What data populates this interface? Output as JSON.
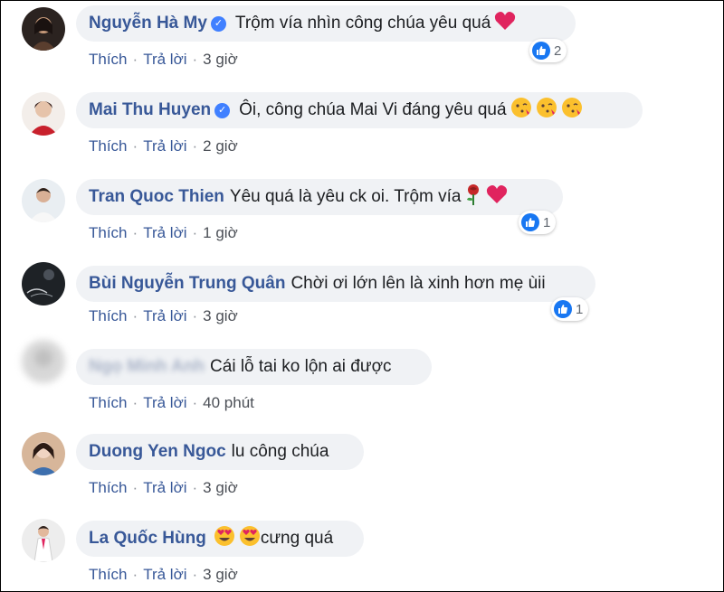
{
  "actions": {
    "like": "Thích",
    "reply": "Trả lời",
    "separator": "·"
  },
  "comments": [
    {
      "author": "Nguyễn Hà My",
      "text": "Trộm vía nhìn công chúa yêu quá",
      "time": "3 giờ",
      "reactions": "2",
      "verified": true,
      "emojis": [
        "heart-icon"
      ]
    },
    {
      "author": "Mai Thu Huyen",
      "text": "Ôi, công chúa Mai Vi đáng yêu quá",
      "time": "2 giờ",
      "reactions": "",
      "verified": true,
      "emojis": [
        "kiss-face-icon",
        "kiss-face-icon",
        "kiss-face-icon"
      ]
    },
    {
      "author": "Tran Quoc Thien",
      "text": "Yêu quá là yêu ck oi. Trộm vía",
      "time": "1 giờ",
      "reactions": "1",
      "verified": false,
      "emojis": [
        "rose-icon",
        "heart-icon"
      ]
    },
    {
      "author": "Bùi Nguyễn Trung Quân",
      "text": "Chời ơi lớn lên là xinh hơn mẹ ùii",
      "time": "3 giờ",
      "reactions": "1",
      "verified": false,
      "emojis": []
    },
    {
      "author": "Ngọ Minh Anh",
      "text": "Cái lỗ tai ko lộn ai được",
      "time": "40 phút",
      "reactions": "",
      "verified": false,
      "emojis": []
    },
    {
      "author": "Duong Yen Ngoc",
      "text": "lu công chúa",
      "time": "3 giờ",
      "reactions": "",
      "verified": false,
      "emojis": []
    },
    {
      "author": "La Quốc Hùng",
      "text": "cưng quá",
      "time": "3 giờ",
      "reactions": "",
      "verified": false,
      "emojis": [
        "heart-eyes-icon",
        "heart-eyes-icon"
      ]
    }
  ],
  "colors": {
    "author": "#385898",
    "bubble": "#f0f2f5",
    "like_blue": "#1877f2",
    "heart": "#e0245e"
  }
}
